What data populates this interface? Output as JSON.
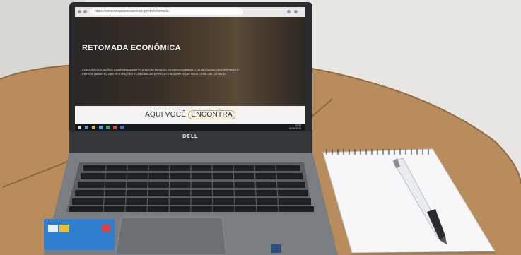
{
  "browser": {
    "url_text": "https://www.mogidascruzes.sp.gov.br/retomada"
  },
  "screen": {
    "title": "RETOMADA ECONÔMICA",
    "subtitle_line1": "CONJUNTO DE AÇÕES COORDENADAS PELA SECRETARIA DE DESENVOLVIMENTO DE MOGI DAS CRUZES PARA O",
    "subtitle_line2": "ENFRENTAMENTO DAS RESTRIÇÕES ECONÔMICAS E PRODUTIVAS IMPOSTAS PELA CRISE DO COVID-19.",
    "cta_prefix": "AQUI VOCÊ ",
    "cta_highlight": "ENCONTRA",
    "taskbar_time": "10:32",
    "taskbar_date": "15/05/2020"
  },
  "laptop": {
    "brand": "DELL"
  },
  "colors": {
    "table": "#b78a5a",
    "wall": "#e6e5e2",
    "laptop_body": "#6f7276",
    "notepad": "#f7f7f9",
    "cta_ring": "#d2a83f"
  }
}
